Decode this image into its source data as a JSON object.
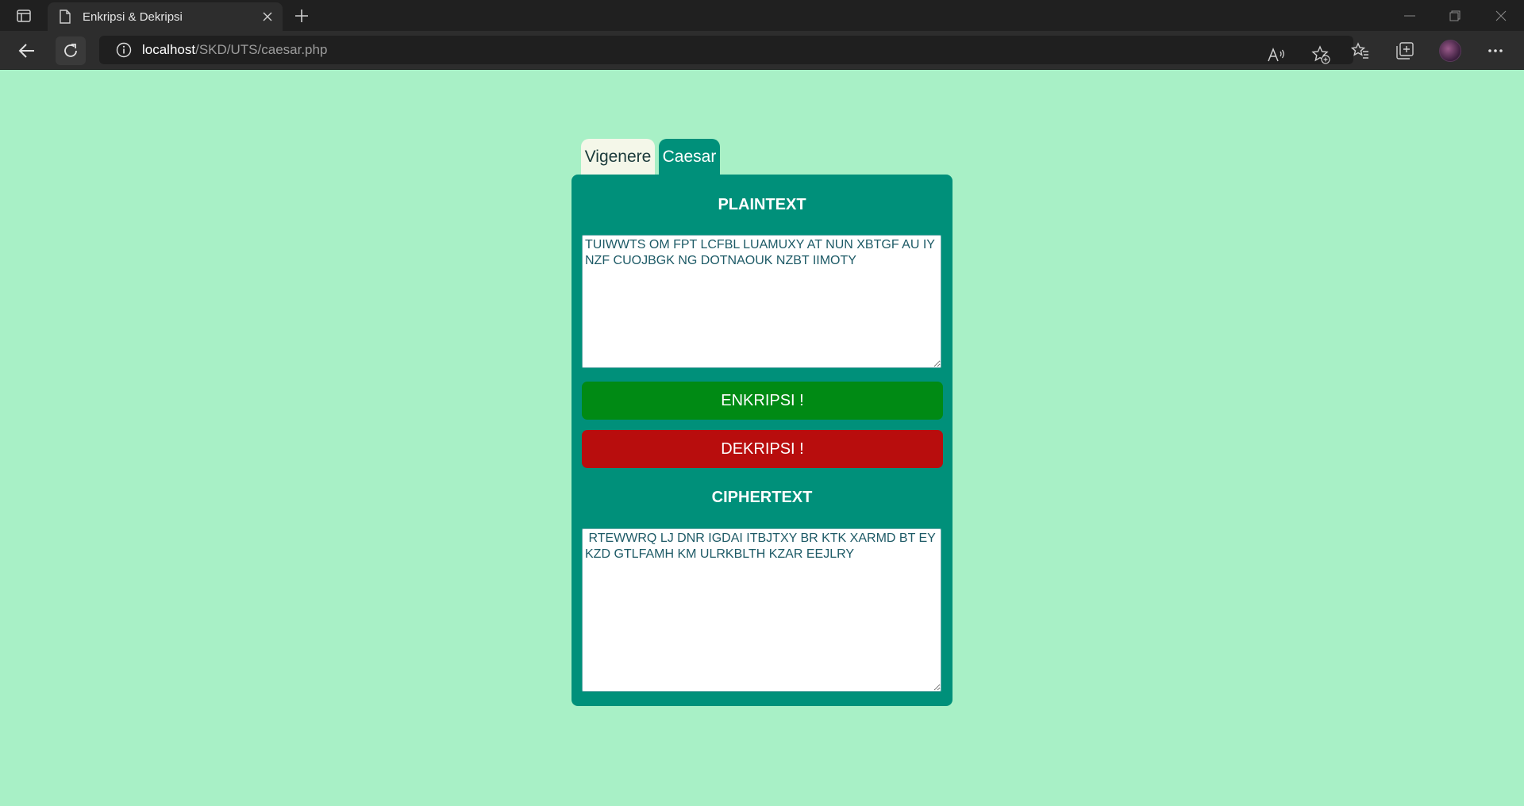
{
  "browser": {
    "tab_title": "Enkripsi & Dekripsi",
    "url_host": "localhost",
    "url_path": "/SKD/UTS/caesar.php"
  },
  "tabs": [
    {
      "label": "Vigenere",
      "active": false
    },
    {
      "label": "Caesar",
      "active": true
    }
  ],
  "form": {
    "plaintext_title": "PLAINTEXT",
    "plaintext_value": "TUIWWTS OM FPT LCFBL LUAMUXY AT NUN XBTGF AU IY NZF CUOJBGK NG DOTNAOUK NZBT IIMOTY",
    "encrypt_label": "ENKRIPSI !",
    "decrypt_label": "DEKRIPSI !",
    "ciphertext_title": "CIPHERTEXT",
    "ciphertext_value": " RTEWWRQ LJ DNR IGDAI ITBJTXY BR KTK XARMD BT EY KZD GTLFAMH KM ULRKBLTH KZAR EEJLRY"
  },
  "colors": {
    "page_background": "#a8f0c6",
    "card": "#00907a",
    "encrypt_button": "#008a14",
    "decrypt_button": "#b80d0d"
  },
  "icons": {
    "tab_actions": "sidebar-toggle-icon",
    "favicon": "page-icon",
    "tab_close": "close-icon",
    "new_tab": "plus-icon",
    "back": "arrow-left-icon",
    "reload": "reload-icon",
    "site_info": "info-icon",
    "read_aloud": "read-aloud-icon",
    "add_favorite": "star-plus-icon",
    "favorites": "favorites-icon",
    "collections": "collections-icon",
    "more": "more-icon"
  }
}
